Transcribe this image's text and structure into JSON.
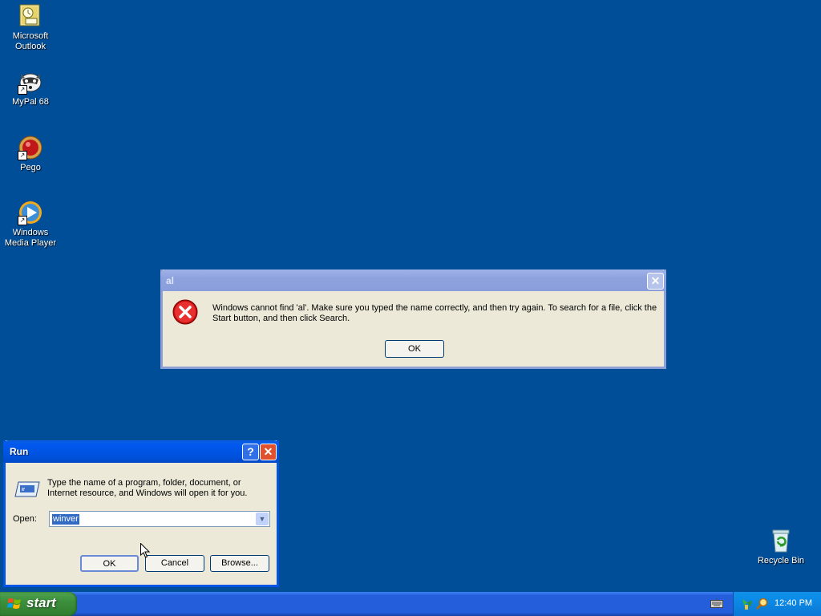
{
  "desktop": {
    "icons": [
      {
        "label": "Microsoft Outlook",
        "icon": "outlook-icon"
      },
      {
        "label": "MyPal 68",
        "icon": "mypal-raccoon-icon"
      },
      {
        "label": "Pego",
        "icon": "pego-red-orb-icon"
      },
      {
        "label": "Windows Media Player",
        "icon": "media-player-icon"
      },
      {
        "label": "Recycle Bin",
        "icon": "recycle-bin-icon"
      }
    ]
  },
  "error_dialog": {
    "title": "al",
    "close_glyph": "✕",
    "message": "Windows cannot find 'al'. Make sure you typed the name correctly, and then try again. To search for a file, click the Start button, and then click Search.",
    "ok_label": "OK"
  },
  "run_dialog": {
    "title": "Run",
    "help_glyph": "?",
    "close_glyph": "✕",
    "description": "Type the name of a program, folder, document, or Internet resource, and Windows will open it for you.",
    "open_label": "Open:",
    "open_value": "winver",
    "ok_label": "OK",
    "cancel_label": "Cancel",
    "browse_label": "Browse..."
  },
  "taskbar": {
    "start_label": "start",
    "clock": "12:40 PM"
  },
  "colors": {
    "desktop": "#004e98",
    "dialog_face": "#ece9d8",
    "title_active": "#0055e5",
    "title_inactive": "#8c9fd6",
    "start_green": "#3c8f3c"
  }
}
